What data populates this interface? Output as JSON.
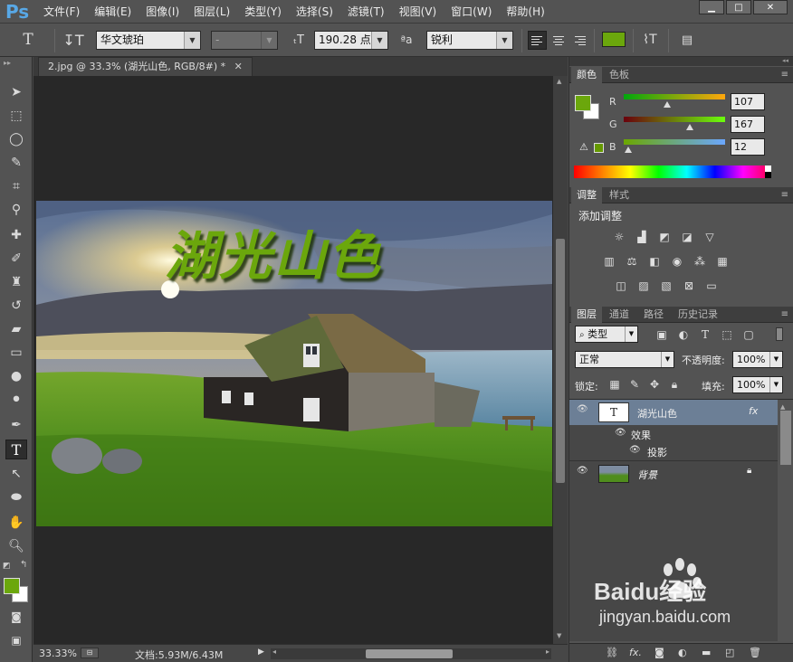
{
  "app": {
    "logo": "Ps"
  },
  "menubar": {
    "items": [
      "文件(F)",
      "编辑(E)",
      "图像(I)",
      "图层(L)",
      "类型(Y)",
      "选择(S)",
      "滤镜(T)",
      "视图(V)",
      "窗口(W)",
      "帮助(H)"
    ]
  },
  "options": {
    "font_family": "华文琥珀",
    "font_style": "-",
    "font_size": "190.28 点",
    "antialias_icon": "ªa",
    "antialias": "锐利",
    "text_color": "#6ba70c"
  },
  "document": {
    "tab_title": "2.jpg @ 33.3% (湖光山色, RGB/8#) *",
    "canvas_text": "湖光山色",
    "text_color": "#6ba70c"
  },
  "status": {
    "zoom": "33.33%",
    "doc_size": "文档:5.93M/6.43M"
  },
  "color_panel": {
    "tabs": [
      "颜色",
      "色板"
    ],
    "labels": {
      "r": "R",
      "g": "G",
      "b": "B"
    },
    "values": {
      "r": "107",
      "g": "167",
      "b": "12"
    },
    "foreground": "#6ba70c",
    "background": "#ffffff"
  },
  "adjust_panel": {
    "tabs": [
      "调整",
      "样式"
    ],
    "title": "添加调整"
  },
  "layers_panel": {
    "tabs": [
      "图层",
      "通道",
      "路径",
      "历史记录"
    ],
    "filter": "类型",
    "blend_mode": "正常",
    "opacity_label": "不透明度:",
    "opacity": "100%",
    "lock_label": "锁定:",
    "fill_label": "填充:",
    "fill": "100%",
    "layers": [
      {
        "name": "湖光山色",
        "fx": "fx"
      },
      {
        "name": "效果"
      },
      {
        "name": "投影"
      },
      {
        "name": "背景"
      }
    ],
    "footer_icons": [
      "link-icon",
      "fx-icon",
      "mask-icon",
      "adjustment-icon",
      "group-icon",
      "new-layer-icon",
      "trash-icon"
    ]
  },
  "watermark": {
    "brand": "Baidu经验",
    "url": "jingyan.baidu.com"
  }
}
